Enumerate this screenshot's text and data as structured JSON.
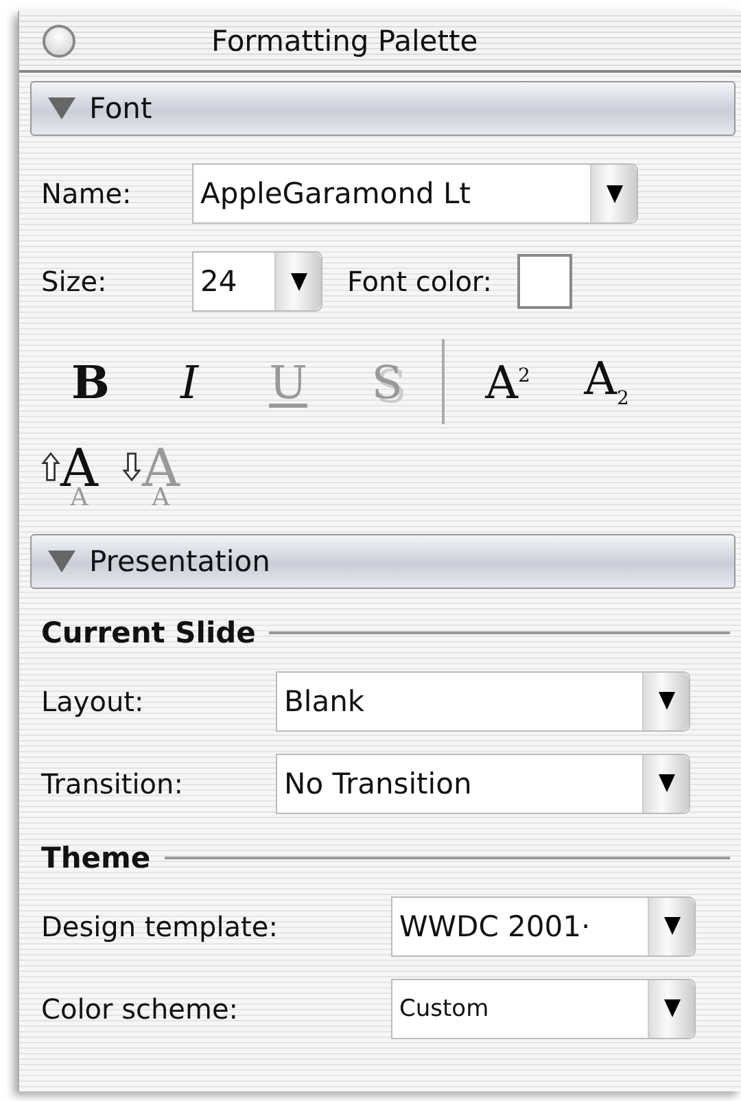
{
  "window": {
    "title": "Formatting Palette"
  },
  "sections": [
    {
      "title": "Font",
      "expanded": true,
      "kind": "font",
      "name": {
        "label": "Name:",
        "value": "AppleGaramond Lt"
      },
      "size": {
        "label": "Size:",
        "value": "24"
      },
      "font_color": {
        "label": "Font color:",
        "color": "#ffffff"
      },
      "styles": [
        {
          "label": "B",
          "kind": "bold",
          "disabled": false
        },
        {
          "label": "I",
          "kind": "italic",
          "disabled": false
        },
        {
          "label": "U",
          "kind": "underline",
          "disabled": true
        },
        {
          "label": "S",
          "kind": "shadow",
          "disabled": true
        },
        {
          "kind": "separator"
        },
        {
          "label": "A$^{2}$",
          "kind": "plain",
          "disabled": false
        },
        {
          "label": "A$_{2}$",
          "kind": "plain",
          "disabled": false
        }
      ],
      "sizing": [
        {
          "label": "A",
          "sub": "A",
          "kind": "grow",
          "disabled": false
        },
        {
          "label": "A",
          "sub": "A",
          "kind": "shrink",
          "disabled": true
        }
      ]
    },
    {
      "title": "Presentation",
      "expanded": true,
      "kind": "groups",
      "groups": [
        {
          "title": "Current Slide",
          "fields": [
            {
              "label": "Layout:",
              "value": "Blank"
            },
            {
              "label": "Transition:",
              "value": "No Transition"
            }
          ]
        },
        {
          "title": "Theme",
          "fields": [
            {
              "label": "Design template:",
              "value": "WWDC 2001·"
            },
            {
              "label": "Color scheme:",
              "value": "Custom",
              "small": true
            }
          ]
        }
      ]
    }
  ]
}
